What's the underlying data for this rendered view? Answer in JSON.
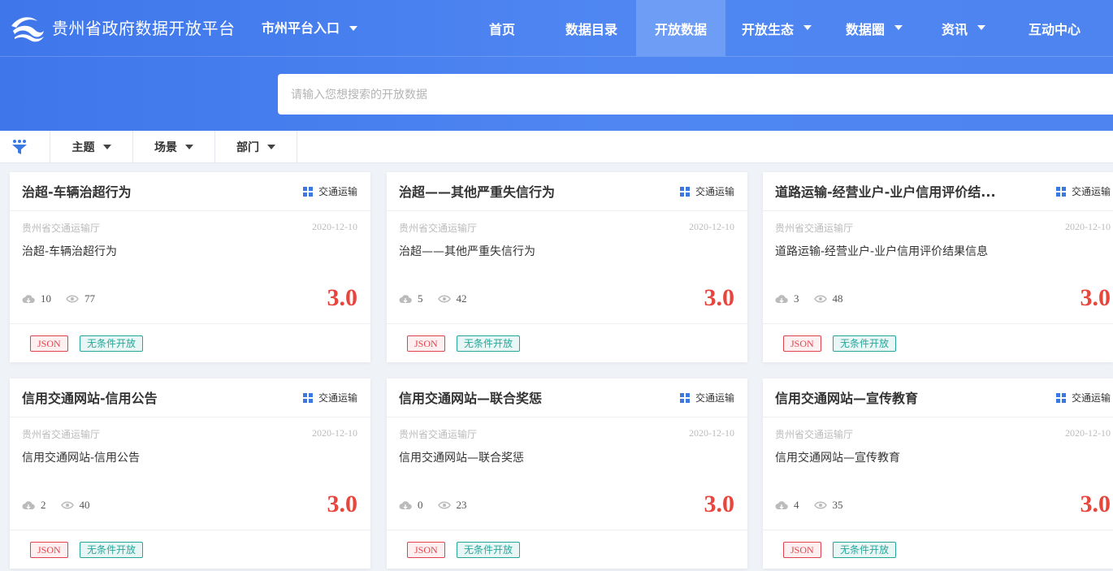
{
  "header": {
    "brand": "贵州省政府数据开放平台",
    "city_entry": "市州平台入口",
    "nav": [
      {
        "label": "首页"
      },
      {
        "label": "数据目录"
      },
      {
        "label": "开放数据"
      },
      {
        "label": "开放生态"
      },
      {
        "label": "数据圈"
      },
      {
        "label": "资讯"
      },
      {
        "label": "互动中心"
      }
    ],
    "active_nav": "开放数据"
  },
  "search": {
    "placeholder": "请输入您想搜索的开放数据"
  },
  "filters": {
    "theme": "主题",
    "scene": "场景",
    "department": "部门"
  },
  "colors": {
    "header_blue": "#4a80ef",
    "active_nav": "#6e9df5",
    "score_red": "#e8453c",
    "json_tag": "#e0434d",
    "open_tag": "#26a69a",
    "category_icon": "#3a78e2"
  },
  "cards": [
    {
      "title": "治超-车辆治超行为",
      "category": "交通运输",
      "department": "贵州省交通运输厅",
      "date": "2020-12-10",
      "description": "治超-车辆治超行为",
      "downloads": "10",
      "views": "77",
      "score": "3.0",
      "tags": [
        "JSON",
        "无条件开放"
      ]
    },
    {
      "title": "治超——其他严重失信行为",
      "category": "交通运输",
      "department": "贵州省交通运输厅",
      "date": "2020-12-10",
      "description": "治超——其他严重失信行为",
      "downloads": "5",
      "views": "42",
      "score": "3.0",
      "tags": [
        "JSON",
        "无条件开放"
      ]
    },
    {
      "title": "道路运输-经营业户-业户信用评价结...",
      "category": "交通运输",
      "department": "贵州省交通运输厅",
      "date": "2020-12-10",
      "description": "道路运输-经营业户-业户信用评价结果信息",
      "downloads": "3",
      "views": "48",
      "score": "3.0",
      "tags": [
        "JSON",
        "无条件开放"
      ]
    },
    {
      "title": "信用交通网站-信用公告",
      "category": "交通运输",
      "department": "贵州省交通运输厅",
      "date": "2020-12-10",
      "description": "信用交通网站-信用公告",
      "downloads": "2",
      "views": "40",
      "score": "3.0",
      "tags": [
        "JSON",
        "无条件开放"
      ]
    },
    {
      "title": "信用交通网站—联合奖惩",
      "category": "交通运输",
      "department": "贵州省交通运输厅",
      "date": "2020-12-10",
      "description": "信用交通网站—联合奖惩",
      "downloads": "0",
      "views": "23",
      "score": "3.0",
      "tags": [
        "JSON",
        "无条件开放"
      ]
    },
    {
      "title": "信用交通网站—宣传教育",
      "category": "交通运输",
      "department": "贵州省交通运输厅",
      "date": "2020-12-10",
      "description": "信用交通网站—宣传教育",
      "downloads": "4",
      "views": "35",
      "score": "3.0",
      "tags": [
        "JSON",
        "无条件开放"
      ]
    }
  ]
}
